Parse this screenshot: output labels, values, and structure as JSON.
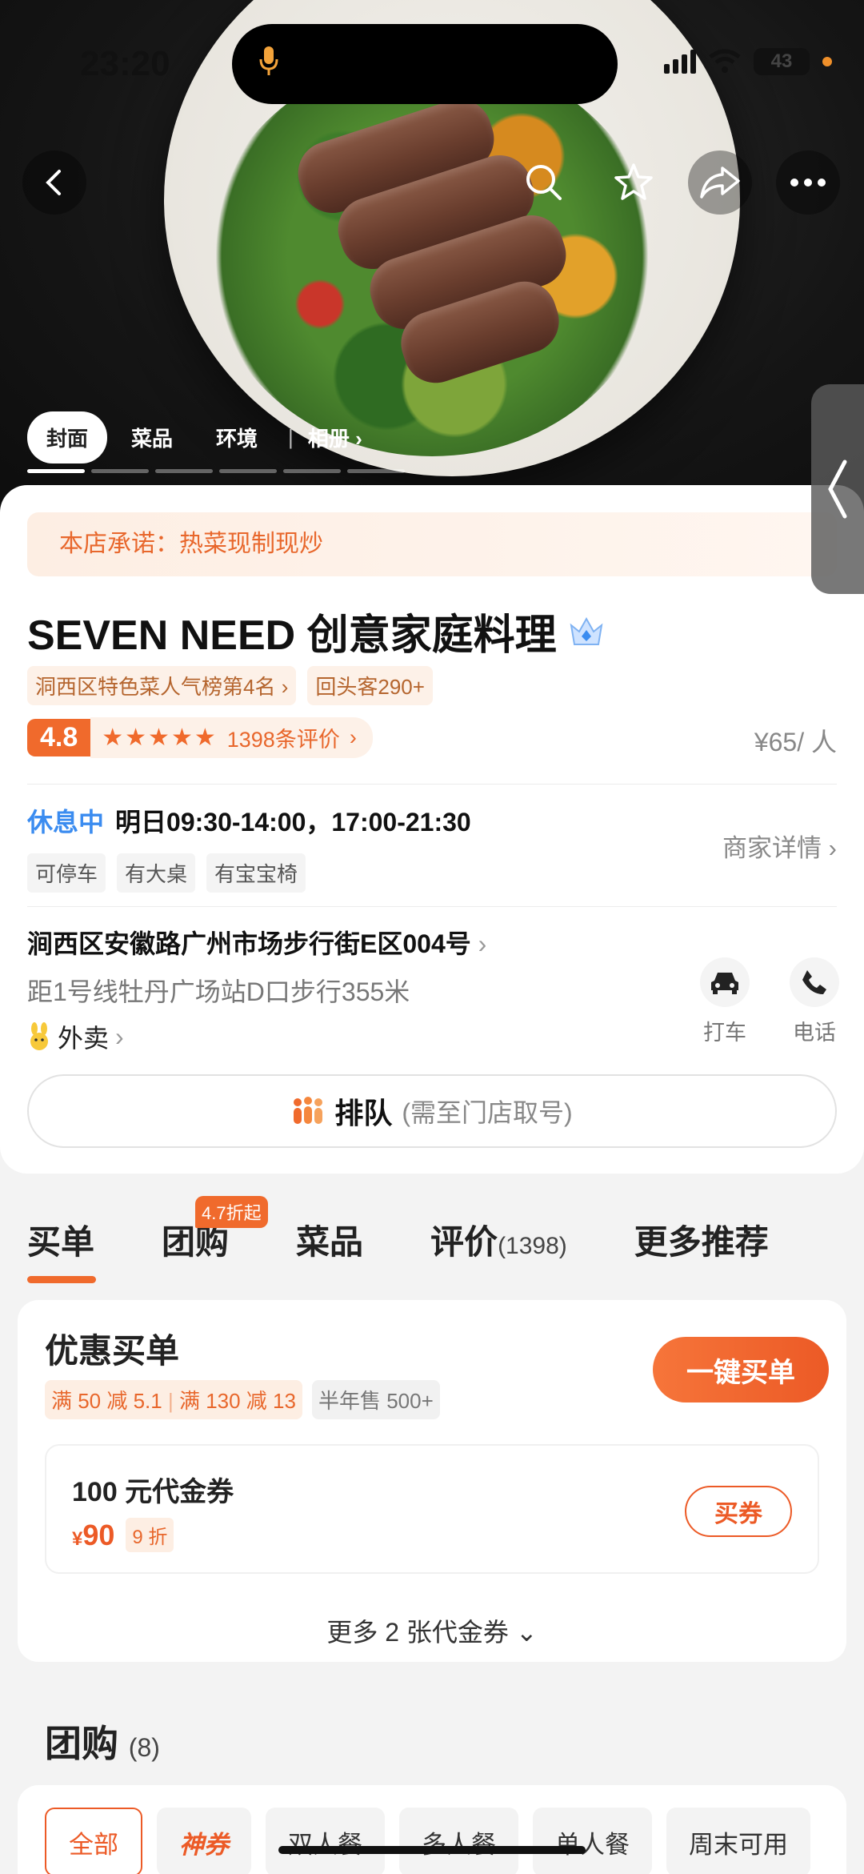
{
  "status_bar": {
    "time": "23:20",
    "battery": "43"
  },
  "gallery": {
    "tabs": [
      "封面",
      "菜品",
      "环境"
    ],
    "album_label": "相册",
    "album_chevron": "›",
    "dot_count": 6
  },
  "store": {
    "promise": "本店承诺：热菜现制现炒",
    "name": "SEVEN NEED 创意家庭料理",
    "rank_badge": "洞西区特色菜人气榜第4名",
    "chevron": "›",
    "repeat_badge": "回头客290+",
    "score": "4.8",
    "stars": "★★★★★",
    "reviews": "1398条评价",
    "price": "¥65/ 人",
    "status": "休息中",
    "hours": "明日09:30-14:00，17:00-21:30",
    "tags": [
      "可停车",
      "有大桌",
      "有宝宝椅"
    ],
    "details": "商家详情",
    "address": "涧西区安徽路广州市场步行街E区004号",
    "distance": "距1号线牡丹广场站D口步行355米",
    "delivery": "外卖",
    "actions": {
      "taxi": "打车",
      "call": "电话"
    },
    "queue": {
      "title": "排队",
      "subtitle": "(需至门店取号)"
    }
  },
  "tabs": {
    "items": [
      {
        "label": "买单",
        "count": ""
      },
      {
        "label": "团购",
        "count": ""
      },
      {
        "label": "菜品",
        "count": ""
      },
      {
        "label": "评价",
        "count": "(1398)"
      },
      {
        "label": "更多推荐",
        "count": ""
      }
    ],
    "badge": "4.7折起"
  },
  "buy": {
    "title": "优惠买单",
    "offer_1": "满 50 减 5.1",
    "offer_2": "满 130 减 13",
    "offer_sep": "|",
    "sales": "半年售 500+",
    "button": "一键买单",
    "voucher": {
      "title": "100 元代金券",
      "currency": "¥",
      "price": "90",
      "discount": "9 折",
      "button": "买券"
    },
    "more": "更多 2 张代金券",
    "more_chevron": "⌄"
  },
  "group": {
    "title": "团购",
    "count": "(8)",
    "filters": [
      "全部",
      "神券",
      "双人餐",
      "多人餐",
      "单人餐",
      "周末可用"
    ]
  },
  "colors": {
    "accent": "#ec5a26",
    "status_blue": "#3b8cf0"
  }
}
